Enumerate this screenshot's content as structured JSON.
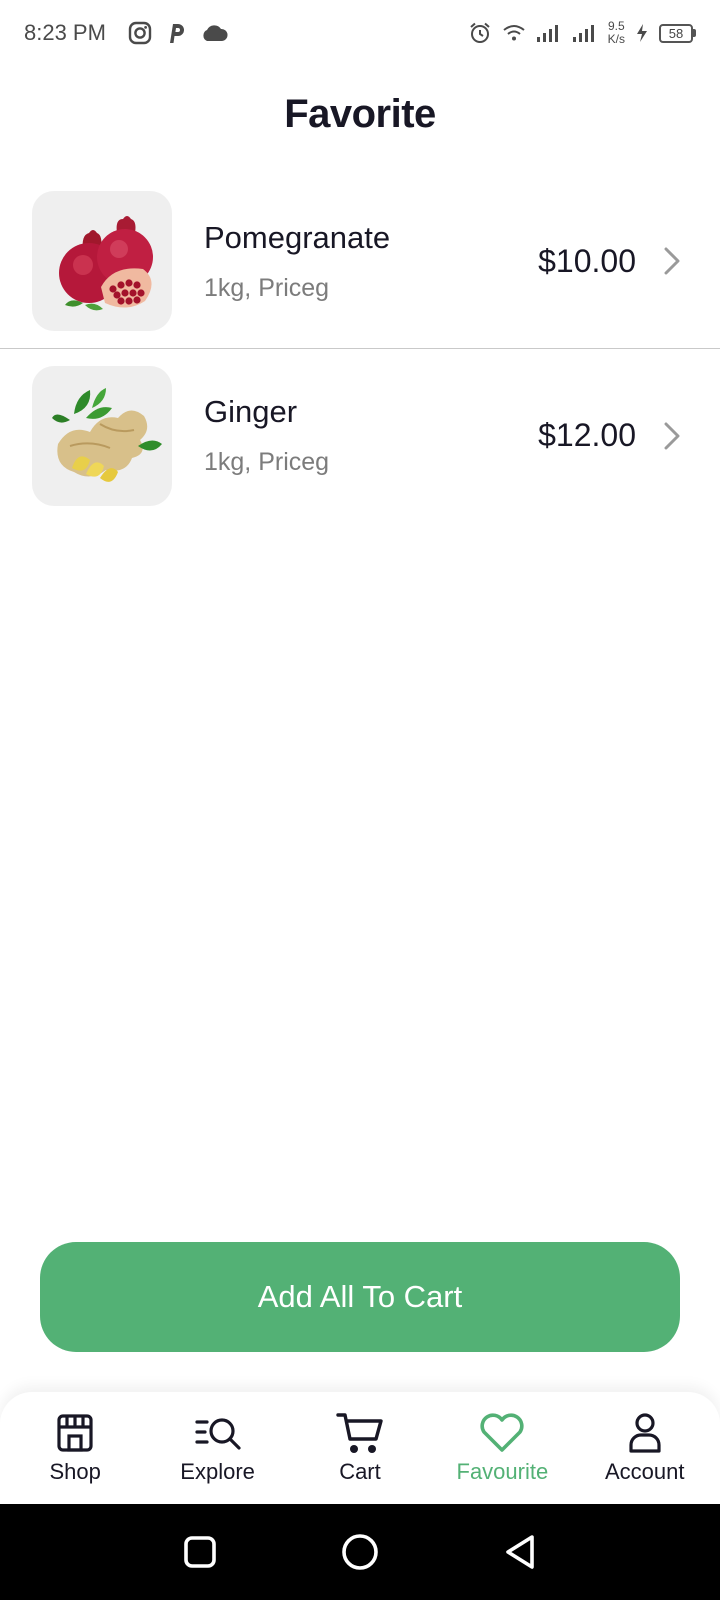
{
  "status_bar": {
    "time": "8:23 PM",
    "speed_value": "9.5",
    "speed_unit": "K/s",
    "battery": "58"
  },
  "header": {
    "title": "Favorite"
  },
  "favorites": [
    {
      "name": "Pomegranate",
      "subtitle": "1kg, Priceg",
      "price": "$10.00"
    },
    {
      "name": "Ginger",
      "subtitle": "1kg, Priceg",
      "price": "$12.00"
    }
  ],
  "cta": {
    "label": "Add All To Cart"
  },
  "bottom_nav": {
    "items": [
      {
        "label": "Shop",
        "icon": "store-icon"
      },
      {
        "label": "Explore",
        "icon": "explore-icon"
      },
      {
        "label": "Cart",
        "icon": "cart-icon"
      },
      {
        "label": "Favourite",
        "icon": "heart-icon",
        "active": true
      },
      {
        "label": "Account",
        "icon": "person-icon"
      }
    ]
  },
  "colors": {
    "accent": "#53b175",
    "text": "#181725",
    "muted": "#7c7c7c"
  }
}
